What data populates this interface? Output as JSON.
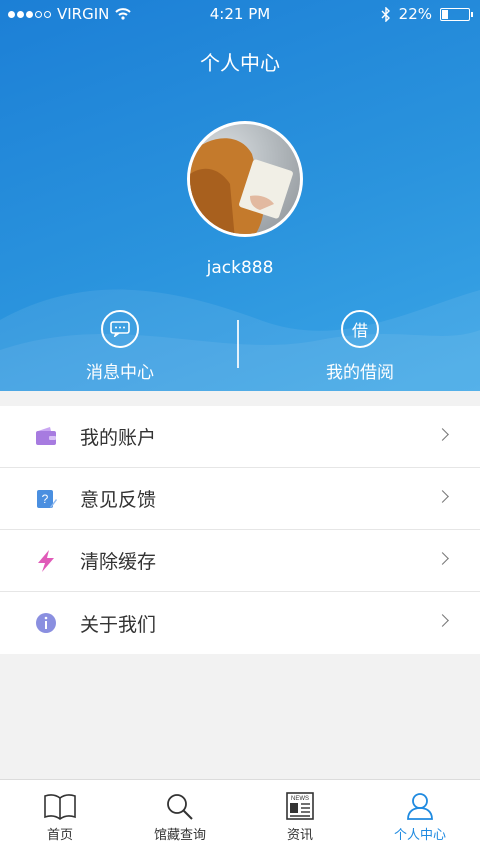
{
  "status_bar": {
    "carrier": "VIRGIN",
    "time": "4:21 PM",
    "battery": "22%",
    "battery_level": 0.22
  },
  "header": {
    "title": "个人中心",
    "username": "jack888"
  },
  "quick_actions": [
    {
      "label": "消息中心",
      "icon": "chat-bubble-icon"
    },
    {
      "label": "我的借阅",
      "icon_text": "借"
    }
  ],
  "menu": [
    {
      "label": "我的账户",
      "icon": "wallet-icon",
      "color": "#a77be0"
    },
    {
      "label": "意见反馈",
      "icon": "feedback-icon",
      "color": "#4a8fe0"
    },
    {
      "label": "清除缓存",
      "icon": "lightning-icon",
      "color": "#e05ab8"
    },
    {
      "label": "关于我们",
      "icon": "info-icon",
      "color": "#8a8fe0"
    }
  ],
  "tabs": [
    {
      "label": "首页",
      "icon": "book-icon"
    },
    {
      "label": "馆藏查询",
      "icon": "search-icon"
    },
    {
      "label": "资讯",
      "icon": "newspaper-icon",
      "icon_text": "NEWS"
    },
    {
      "label": "个人中心",
      "icon": "person-icon",
      "active": true
    }
  ],
  "colors": {
    "accent": "#1f8ae0",
    "header_top": "#1c7fd6",
    "header_bottom": "#3aa5e6"
  }
}
